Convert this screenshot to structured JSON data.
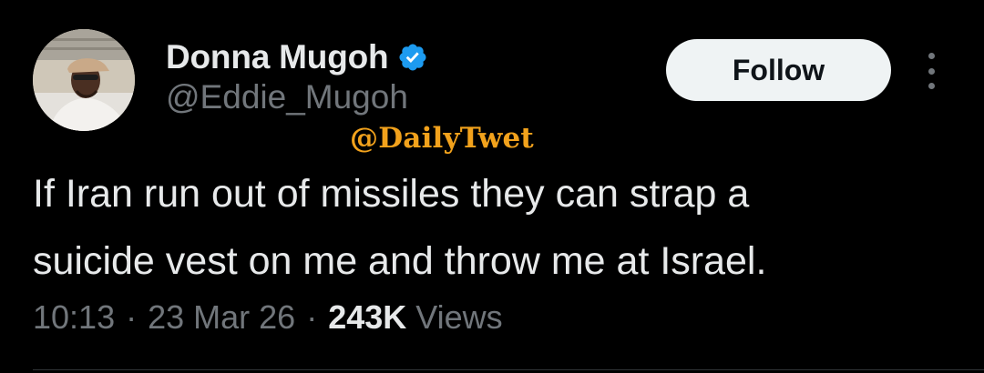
{
  "profile": {
    "display_name": "Donna Mugoh",
    "handle": "@Eddie_Mugoh",
    "verified": true,
    "verified_color": "#1d9bf0"
  },
  "watermark": {
    "text": "@DailyTwet",
    "color": "#f2a21c"
  },
  "actions": {
    "follow_label": "Follow",
    "more_icon": "more-vertical-icon"
  },
  "tweet": {
    "text": "If Iran run out of missiles they can strap a\nsuicide vest on me and throw me at Israel.",
    "time": "10:13",
    "separator": "·",
    "date": "23 Mar 26",
    "views_count": "243K",
    "views_label": "Views"
  },
  "colors": {
    "background": "#000000",
    "primary_text": "#e7e9ea",
    "secondary_text": "#71767b",
    "follow_bg": "#eff3f4"
  }
}
